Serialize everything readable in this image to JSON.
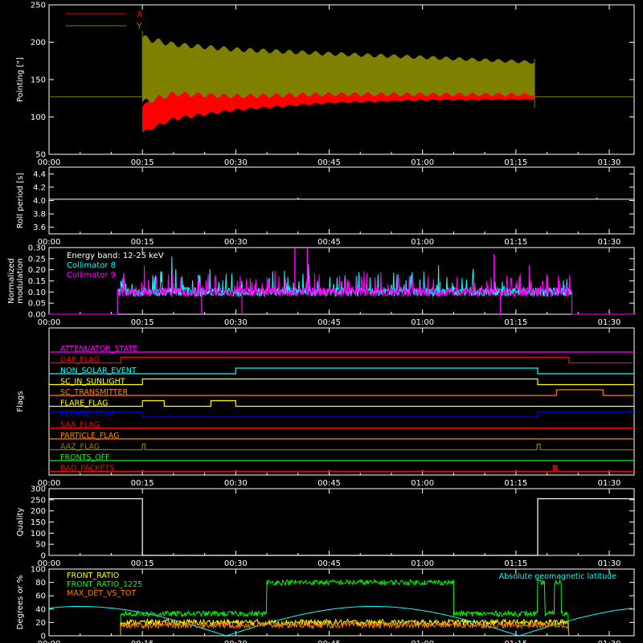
{
  "time_ticks": [
    "00:00",
    "00:15",
    "00:30",
    "00:45",
    "01:00",
    "01:15",
    "01:30"
  ],
  "chart_data": [
    {
      "type": "area",
      "ylabel": "Pointing [\"]",
      "ylim": [
        50,
        250
      ],
      "yticks": [
        "50",
        "100",
        "150",
        "200",
        "250"
      ],
      "legend": [
        {
          "name": "X",
          "color": "#ff0000"
        },
        {
          "name": "Y",
          "color": "#808000"
        }
      ],
      "start_minute": 15,
      "end_minute": 78,
      "series": [
        {
          "name": "X",
          "color": "#ff0000",
          "env_minutes": [
            15,
            20,
            30,
            45,
            60,
            78
          ],
          "upper": [
            115,
            150,
            145,
            143,
            140,
            140
          ],
          "lower": [
            78,
            95,
            108,
            118,
            122,
            123
          ]
        },
        {
          "name": "Y",
          "color": "#808000",
          "env_minutes": [
            15,
            20,
            30,
            45,
            60,
            78
          ],
          "upper": [
            210,
            200,
            193,
            187,
            182,
            175
          ],
          "lower": [
            115,
            128,
            125,
            128,
            128,
            128
          ]
        }
      ],
      "baseline": 127
    },
    {
      "type": "line",
      "ylabel": "Roll period [s]",
      "ylim": [
        3.5,
        4.5
      ],
      "yticks": [
        "3.6",
        "3.8",
        "4.0",
        "4.2",
        "4.4"
      ],
      "x": [
        0,
        94
      ],
      "y": [
        4.02,
        4.02
      ]
    },
    {
      "type": "line",
      "ylabel": "Normalized modulation",
      "ylim": [
        0,
        0.3
      ],
      "yticks": [
        "0.00",
        "0.05",
        "0.10",
        "0.15",
        "0.20",
        "0.25",
        "0.30"
      ],
      "annotation": "Energy band: 12-25 keV",
      "start_minute": 11,
      "end_minute": 84,
      "series": [
        {
          "name": "Collimator 8",
          "color": "#00ffff",
          "mean": 0.1
        },
        {
          "name": "Collimator 9",
          "color": "#ff00ff",
          "mean": 0.1
        }
      ],
      "spikes": [
        {
          "minute": 39.5,
          "value": 0.3,
          "color": "#ff00ff"
        },
        {
          "minute": 41.5,
          "value": 0.3,
          "color": "#ff00ff"
        },
        {
          "minute": 71.5,
          "value": 0.27,
          "color": "#ff00ff"
        }
      ],
      "dips": [
        {
          "minute": 24.5,
          "color": "#ff00ff"
        },
        {
          "minute": 31.0,
          "color": "#ff00ff"
        },
        {
          "minute": 72.5,
          "color": "#ff00ff"
        }
      ]
    },
    {
      "type": "line",
      "ylabel": "Flags",
      "flags": [
        {
          "name": "ATTENUATOR_STATE",
          "color": "#ff00ff",
          "steps": [
            [
              0,
              0
            ],
            [
              94,
              0
            ]
          ]
        },
        {
          "name": "GAP_FLAG",
          "color": "#ff0000",
          "steps": [
            [
              0,
              0
            ],
            [
              11.5,
              0
            ],
            [
              11.5,
              1
            ],
            [
              83.5,
              1
            ],
            [
              83.5,
              0
            ],
            [
              94,
              0
            ]
          ]
        },
        {
          "name": "NON_SOLAR_EVENT",
          "color": "#00ffff",
          "steps": [
            [
              0,
              0
            ],
            [
              30,
              0
            ],
            [
              30,
              1
            ],
            [
              78.5,
              1
            ],
            [
              78.5,
              0
            ],
            [
              94,
              0
            ]
          ]
        },
        {
          "name": "SC_IN_SUNLIGHT",
          "color": "#ffff00",
          "steps": [
            [
              0,
              0
            ],
            [
              15,
              0
            ],
            [
              15,
              1
            ],
            [
              78.5,
              1
            ],
            [
              78.5,
              0
            ],
            [
              94,
              0
            ]
          ]
        },
        {
          "name": "SC_TRANSMITTER",
          "color": "#ff7f00",
          "steps": [
            [
              0,
              0
            ],
            [
              81.5,
              0
            ],
            [
              81.5,
              1
            ],
            [
              89,
              1
            ],
            [
              89,
              0
            ],
            [
              94,
              0
            ]
          ]
        },
        {
          "name": "FLARE_FLAG",
          "color": "#ffff00",
          "steps": [
            [
              0,
              0
            ],
            [
              15,
              0
            ],
            [
              15,
              1
            ],
            [
              18.5,
              1
            ],
            [
              18.5,
              0
            ],
            [
              26,
              0
            ],
            [
              26,
              1
            ],
            [
              30,
              1
            ],
            [
              30,
              0
            ],
            [
              94,
              0
            ]
          ]
        },
        {
          "name": "ECLIPSE_FLAG",
          "color": "#0000ff",
          "steps": [
            [
              0,
              1
            ],
            [
              15,
              1
            ],
            [
              15,
              0
            ],
            [
              78.5,
              0
            ],
            [
              78.5,
              1
            ],
            [
              94,
              1
            ]
          ]
        },
        {
          "name": "SAA_FLAG",
          "color": "#ff0000",
          "steps": [
            [
              0,
              0
            ],
            [
              94,
              0
            ]
          ]
        },
        {
          "name": "PARTICLE_FLAG",
          "color": "#ff7f00",
          "steps": [
            [
              0,
              0
            ],
            [
              94,
              0
            ]
          ]
        },
        {
          "name": "AAZ_FLAG",
          "color": "#808000",
          "steps": [
            [
              0,
              0
            ],
            [
              15,
              0
            ],
            [
              15,
              1
            ],
            [
              15.4,
              1
            ],
            [
              15.4,
              0
            ],
            [
              78.4,
              0
            ],
            [
              78.4,
              1
            ],
            [
              78.9,
              1
            ],
            [
              78.9,
              0
            ],
            [
              94,
              0
            ]
          ]
        },
        {
          "name": "FRONTS_OFF",
          "color": "#00ff00",
          "steps": [
            [
              0,
              0
            ],
            [
              94,
              0
            ]
          ]
        },
        {
          "name": "BAD_PACKETS",
          "color": "#ff0000",
          "steps": [
            [
              0,
              0
            ],
            [
              81,
              0
            ],
            [
              81,
              1
            ],
            [
              81.2,
              1
            ],
            [
              81.2,
              0
            ],
            [
              81.4,
              0
            ],
            [
              81.4,
              1
            ],
            [
              81.6,
              1
            ],
            [
              81.6,
              0
            ],
            [
              94,
              0
            ]
          ]
        }
      ]
    },
    {
      "type": "line",
      "ylabel": "Quality",
      "ylim": [
        0,
        300
      ],
      "yticks": [
        "0",
        "50",
        "100",
        "150",
        "200",
        "250",
        "300"
      ],
      "x": [
        0,
        15,
        15,
        78.5,
        78.5,
        94
      ],
      "y": [
        255,
        255,
        0,
        0,
        255,
        255
      ]
    },
    {
      "type": "line",
      "ylabel": "Degrees or %",
      "ylim": [
        0,
        100
      ],
      "yticks": [
        "0",
        "20",
        "40",
        "60",
        "80",
        "100"
      ],
      "legend_left": [
        {
          "name": "FRONT_RATIO",
          "color": "#ffff00"
        },
        {
          "name": "FRONT_RATIO_1225",
          "color": "#00ff00"
        },
        {
          "name": "MAX_DET_VS_TOT",
          "color": "#ff7f00"
        }
      ],
      "legend_right": {
        "name": "Absolute geomagnetic latitude",
        "color": "#00ffff"
      },
      "start_minute": 11.5,
      "end_minute": 83.5,
      "series": [
        {
          "name": "FRONT_RATIO_1225",
          "color": "#00ff00",
          "segments": [
            [
              11.5,
              35,
              33
            ],
            [
              35,
              65,
              80
            ],
            [
              65,
              78.5,
              33
            ],
            [
              78.5,
              79.7,
              80
            ],
            [
              79.7,
              81.2,
              33
            ],
            [
              81.2,
              82.3,
              80
            ],
            [
              82.3,
              83.5,
              33
            ]
          ]
        },
        {
          "name": "FRONT_RATIO",
          "color": "#ffff00",
          "mean": 20
        },
        {
          "name": "MAX_DET_VS_TOT",
          "color": "#ff7f00",
          "mean": 16
        }
      ],
      "latitude": {
        "amplitude": 44,
        "period_minutes": 47,
        "phase_minute": 28.5
      }
    }
  ]
}
